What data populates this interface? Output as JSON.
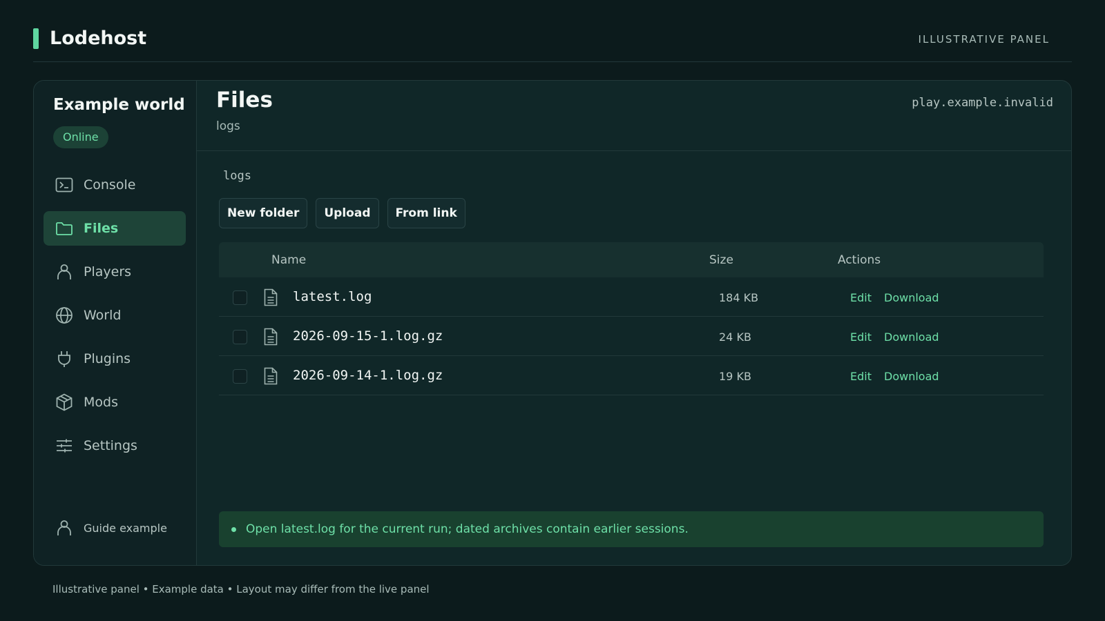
{
  "brand": {
    "name": "Lodehost",
    "accent": "#5fd6a0"
  },
  "top_label": "ILLUSTRATIVE PANEL",
  "sidebar": {
    "server_name": "Example world",
    "status": "Online",
    "items": [
      {
        "label": "Console",
        "icon": "terminal-icon",
        "active": false
      },
      {
        "label": "Files",
        "icon": "folder-icon",
        "active": true
      },
      {
        "label": "Players",
        "icon": "person-icon",
        "active": false
      },
      {
        "label": "World",
        "icon": "globe-icon",
        "active": false
      },
      {
        "label": "Plugins",
        "icon": "plug-icon",
        "active": false
      },
      {
        "label": "Mods",
        "icon": "box-icon",
        "active": false
      },
      {
        "label": "Settings",
        "icon": "sliders-icon",
        "active": false
      }
    ],
    "user": {
      "label": "Guide example",
      "icon": "person-icon"
    }
  },
  "main": {
    "title": "Files",
    "subtitle": "logs",
    "address": "play.example.invalid",
    "path": "logs",
    "toolbar": {
      "new_folder": "New folder",
      "upload": "Upload",
      "from_link": "From link"
    },
    "table": {
      "headers": {
        "name": "Name",
        "size": "Size",
        "actions": "Actions"
      },
      "rows": [
        {
          "name": "latest.log",
          "size": "184 KB",
          "edit": "Edit",
          "download": "Download"
        },
        {
          "name": "2026-09-15-1.log.gz",
          "size": "24 KB",
          "edit": "Edit",
          "download": "Download"
        },
        {
          "name": "2026-09-14-1.log.gz",
          "size": "19 KB",
          "edit": "Edit",
          "download": "Download"
        }
      ]
    },
    "notice": "Open latest.log for the current run; dated archives contain earlier sessions."
  },
  "footer": "Illustrative panel • Example data • Layout may differ from the live panel"
}
